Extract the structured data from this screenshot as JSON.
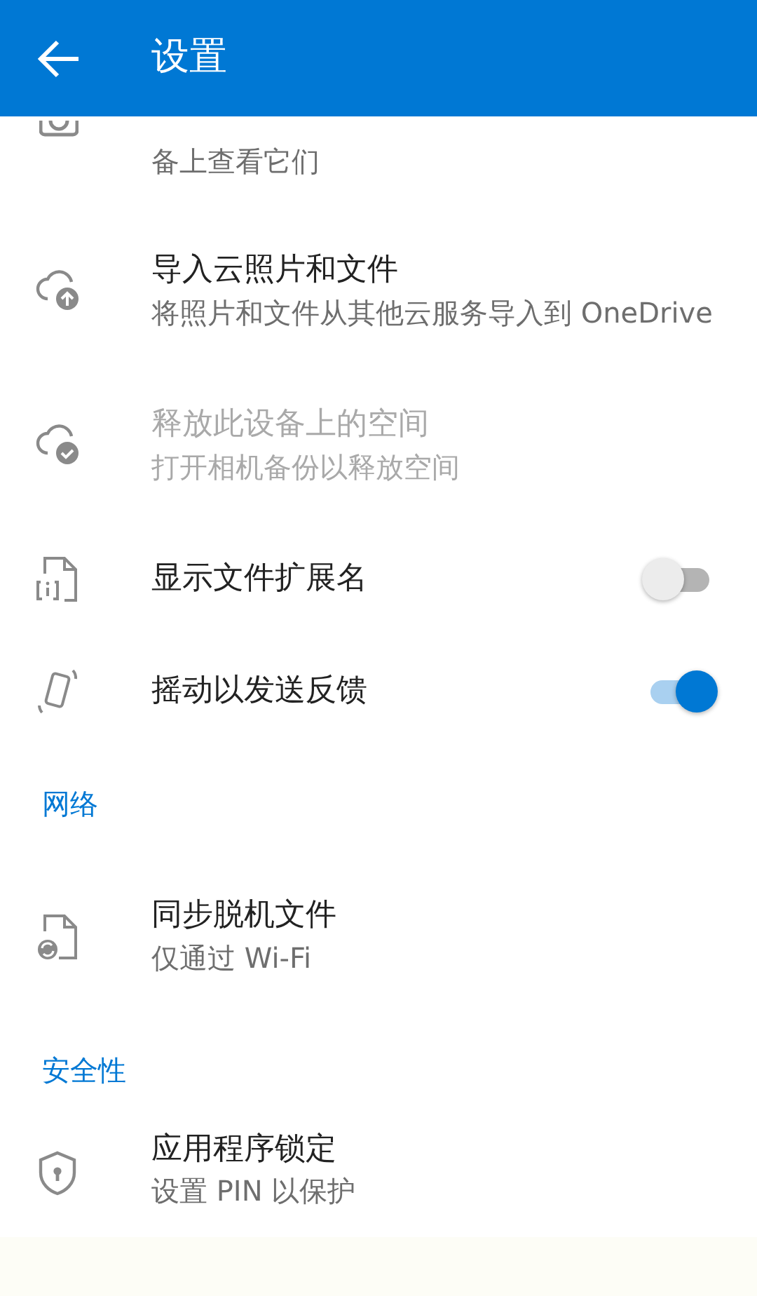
{
  "header": {
    "title": "设置"
  },
  "rows": [
    {
      "kind": "item",
      "description": "备上查看它们",
      "disabled": false
    },
    {
      "kind": "item",
      "title": "导入云照片和文件",
      "description": "将照片和文件从其他云服务导入到 OneDrive",
      "disabled": false
    },
    {
      "kind": "item",
      "title": "释放此设备上的空间",
      "description": "打开相机备份以释放空间",
      "disabled": true
    },
    {
      "kind": "toggle",
      "title": "显示文件扩展名",
      "on": false
    },
    {
      "kind": "toggle",
      "title": "摇动以发送反馈",
      "on": true
    },
    {
      "kind": "section",
      "title": "网络"
    },
    {
      "kind": "item",
      "title": "同步脱机文件",
      "description": "仅通过 Wi-Fi",
      "disabled": false
    },
    {
      "kind": "section",
      "title": "安全性"
    },
    {
      "kind": "item",
      "title": "应用程序锁定",
      "description": "设置 PIN 以保护",
      "disabled": false
    }
  ]
}
